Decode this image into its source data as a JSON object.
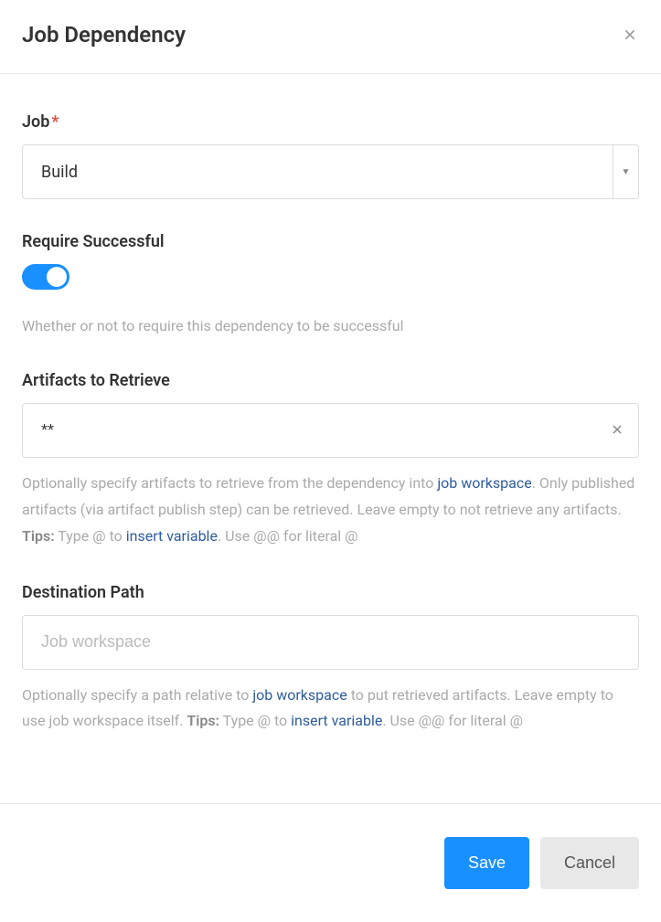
{
  "header": {
    "title": "Job Dependency"
  },
  "form": {
    "job": {
      "label": "Job",
      "value": "Build"
    },
    "requireSuccessful": {
      "label": "Require Successful",
      "enabled": true,
      "help": "Whether or not to require this dependency to be successful"
    },
    "artifacts": {
      "label": "Artifacts to Retrieve",
      "value": "**",
      "help1": "Optionally specify artifacts to retrieve from the dependency into ",
      "helpLink1": "job workspace",
      "help2": ". Only published artifacts (via artifact publish step) can be retrieved. Leave empty to not retrieve any artifacts. ",
      "tipsLabel": "Tips:",
      "tips1": " Type @ to ",
      "tipsLink": "insert variable",
      "tips2": ". Use @@ for literal @"
    },
    "destination": {
      "label": "Destination Path",
      "placeholder": "Job workspace",
      "help1": "Optionally specify a path relative to ",
      "helpLink1": "job workspace",
      "help2": " to put retrieved artifacts. Leave empty to use job workspace itself. ",
      "tipsLabel": "Tips:",
      "tips1": " Type @ to ",
      "tipsLink": "insert variable",
      "tips2": ". Use @@ for literal @"
    }
  },
  "footer": {
    "save": "Save",
    "cancel": "Cancel"
  }
}
